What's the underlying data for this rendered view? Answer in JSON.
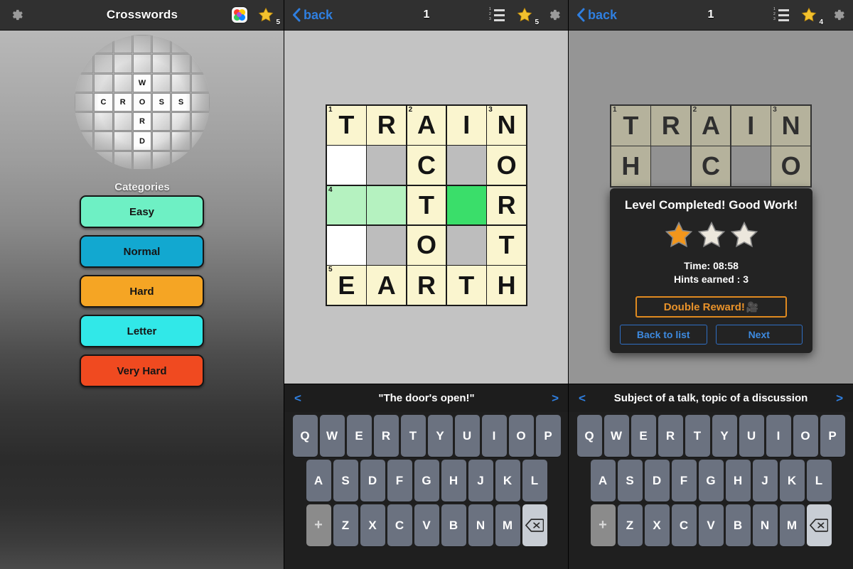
{
  "menu_panel": {
    "header": {
      "settings_icon": "gear-icon",
      "title": "Crosswords",
      "more_apps_icon": "app-grid-icon",
      "star_icon": "star-icon",
      "star_count": "5"
    },
    "logo": {
      "across_word": "CROSS",
      "down_word": "WORD",
      "letters": [
        "W",
        "C",
        "R",
        "O",
        "S",
        "S",
        "R",
        "D"
      ]
    },
    "categories_label": "Categories",
    "categories": [
      {
        "label": "Easy",
        "color": "#6ef0c4"
      },
      {
        "label": "Normal",
        "color": "#12a8d0"
      },
      {
        "label": "Hard",
        "color": "#f5a524"
      },
      {
        "label": "Letter",
        "color": "#31e8e8"
      },
      {
        "label": "Very Hard",
        "color": "#f04a20"
      }
    ]
  },
  "play_panel": {
    "header": {
      "back_label": "back",
      "level_number": "1",
      "list_icon": "numbered-list-icon",
      "star_icon": "star-icon",
      "star_count": "5",
      "settings_icon": "gear-icon"
    },
    "grid": {
      "rows": [
        [
          {
            "letter": "T",
            "num": "1",
            "state": "filled"
          },
          {
            "letter": "R",
            "num": "",
            "state": "filled"
          },
          {
            "letter": "A",
            "num": "2",
            "state": "filled"
          },
          {
            "letter": "I",
            "num": "",
            "state": "filled"
          },
          {
            "letter": "N",
            "num": "3",
            "state": "filled"
          }
        ],
        [
          {
            "letter": "",
            "num": "",
            "state": "blank"
          },
          {
            "letter": "",
            "num": "",
            "state": "block"
          },
          {
            "letter": "C",
            "num": "",
            "state": "filled"
          },
          {
            "letter": "",
            "num": "",
            "state": "block"
          },
          {
            "letter": "O",
            "num": "",
            "state": "filled"
          }
        ],
        [
          {
            "letter": "",
            "num": "4",
            "state": "highlight"
          },
          {
            "letter": "",
            "num": "",
            "state": "highlight"
          },
          {
            "letter": "T",
            "num": "",
            "state": "filled"
          },
          {
            "letter": "",
            "num": "",
            "state": "selected"
          },
          {
            "letter": "R",
            "num": "",
            "state": "filled"
          }
        ],
        [
          {
            "letter": "",
            "num": "",
            "state": "blank"
          },
          {
            "letter": "",
            "num": "",
            "state": "block"
          },
          {
            "letter": "O",
            "num": "",
            "state": "filled"
          },
          {
            "letter": "",
            "num": "",
            "state": "block"
          },
          {
            "letter": "T",
            "num": "",
            "state": "filled"
          }
        ],
        [
          {
            "letter": "E",
            "num": "5",
            "state": "filled"
          },
          {
            "letter": "A",
            "num": "",
            "state": "filled"
          },
          {
            "letter": "R",
            "num": "",
            "state": "filled"
          },
          {
            "letter": "T",
            "num": "",
            "state": "filled"
          },
          {
            "letter": "H",
            "num": "",
            "state": "filled"
          }
        ]
      ]
    },
    "clue": {
      "prev_arrow": "<",
      "text": "\"The door's open!\"",
      "next_arrow": ">"
    },
    "keyboard": {
      "row1": [
        "Q",
        "W",
        "E",
        "R",
        "T",
        "Y",
        "U",
        "I",
        "O",
        "P"
      ],
      "row2": [
        "A",
        "S",
        "D",
        "F",
        "G",
        "H",
        "J",
        "K",
        "L"
      ],
      "row3_plus": "+",
      "row3": [
        "Z",
        "X",
        "C",
        "V",
        "B",
        "N",
        "M"
      ],
      "backspace_icon": "backspace-icon"
    }
  },
  "result_panel": {
    "header": {
      "back_label": "back",
      "level_number": "1",
      "list_icon": "numbered-list-icon",
      "star_icon": "star-icon",
      "star_count": "4",
      "settings_icon": "gear-icon"
    },
    "grid": {
      "rows": [
        [
          {
            "letter": "T",
            "num": "1",
            "state": "filled"
          },
          {
            "letter": "R",
            "num": "",
            "state": "filled"
          },
          {
            "letter": "A",
            "num": "2",
            "state": "filled"
          },
          {
            "letter": "I",
            "num": "",
            "state": "filled"
          },
          {
            "letter": "N",
            "num": "3",
            "state": "filled"
          }
        ],
        [
          {
            "letter": "H",
            "num": "",
            "state": "filled"
          },
          {
            "letter": "",
            "num": "",
            "state": "block"
          },
          {
            "letter": "C",
            "num": "",
            "state": "filled"
          },
          {
            "letter": "",
            "num": "",
            "state": "block"
          },
          {
            "letter": "O",
            "num": "",
            "state": "filled"
          }
        ]
      ]
    },
    "dialog": {
      "title": "Level Completed! Good Work!",
      "stars_earned": 1,
      "stars_total": 3,
      "time_label": "Time: 08:58",
      "hints_label": "Hints earned : 3",
      "double_reward_label": "Double Reward!",
      "video_icon": "video-camera-icon",
      "back_to_list_label": "Back to list",
      "next_label": "Next"
    },
    "clue": {
      "prev_arrow": "<",
      "text": "Subject of a talk, topic of a discussion",
      "next_arrow": ">"
    },
    "keyboard": {
      "row1": [
        "Q",
        "W",
        "E",
        "R",
        "T",
        "Y",
        "U",
        "I",
        "O",
        "P"
      ],
      "row2": [
        "A",
        "S",
        "D",
        "F",
        "G",
        "H",
        "J",
        "K",
        "L"
      ],
      "row3_plus": "+",
      "row3": [
        "Z",
        "X",
        "C",
        "V",
        "B",
        "N",
        "M"
      ],
      "backspace_icon": "backspace-icon"
    }
  },
  "colors": {
    "header_bg": "#303030",
    "accent_blue": "#2f7fe0",
    "grid_fill": "#faf5cf",
    "grid_block": "#bdbdbd",
    "grid_highlight": "#b5f2c0",
    "grid_selected": "#3ade6a",
    "star_gold": "#f2c12e",
    "reward_orange": "#e8922a"
  }
}
